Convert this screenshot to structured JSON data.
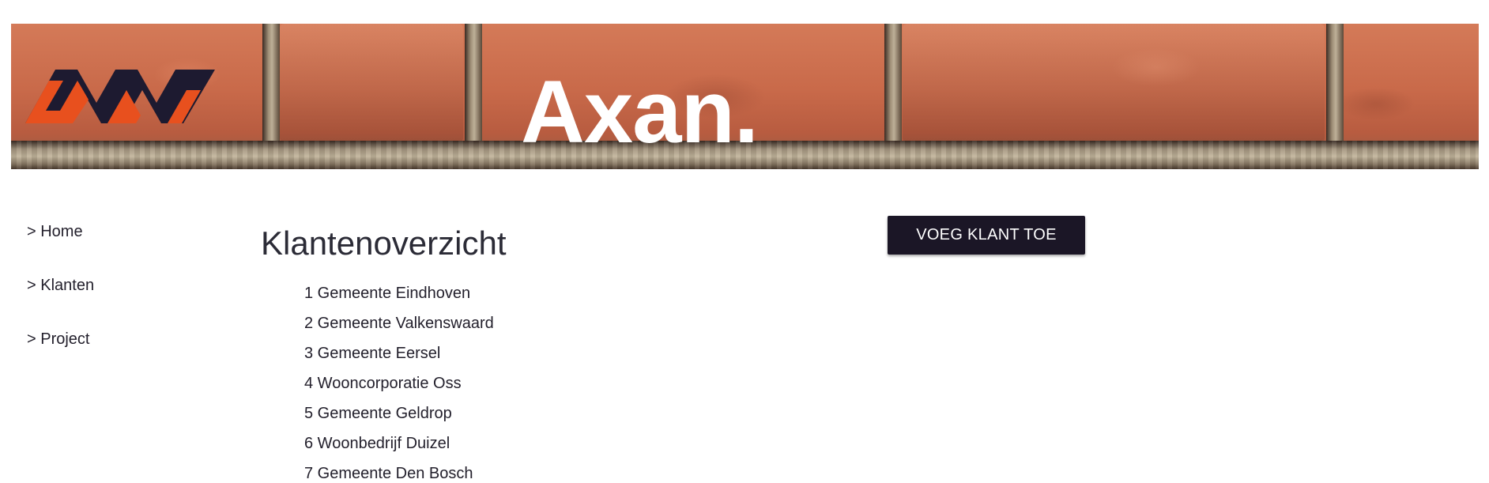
{
  "header": {
    "brand_title": "Axan.",
    "logo_icon": "axan-logo-icon"
  },
  "colors": {
    "button_bg": "#1b1626",
    "text": "#23202c",
    "logo_orange": "#e8501e",
    "logo_navy": "#1d1a30",
    "banner_brick": "#c8694a"
  },
  "sidebar": {
    "items": [
      {
        "label": "> Home"
      },
      {
        "label": "> Klanten"
      },
      {
        "label": "> Project"
      }
    ]
  },
  "main": {
    "title": "Klantenoverzicht",
    "add_button_label": "VOEG KLANT TOE",
    "clients": [
      {
        "label": "1 Gemeente Eindhoven"
      },
      {
        "label": "2 Gemeente Valkenswaard"
      },
      {
        "label": "3 Gemeente Eersel"
      },
      {
        "label": "4 Wooncorporatie Oss"
      },
      {
        "label": "5 Gemeente Geldrop"
      },
      {
        "label": "6 Woonbedrijf Duizel"
      },
      {
        "label": "7 Gemeente Den Bosch"
      }
    ]
  }
}
